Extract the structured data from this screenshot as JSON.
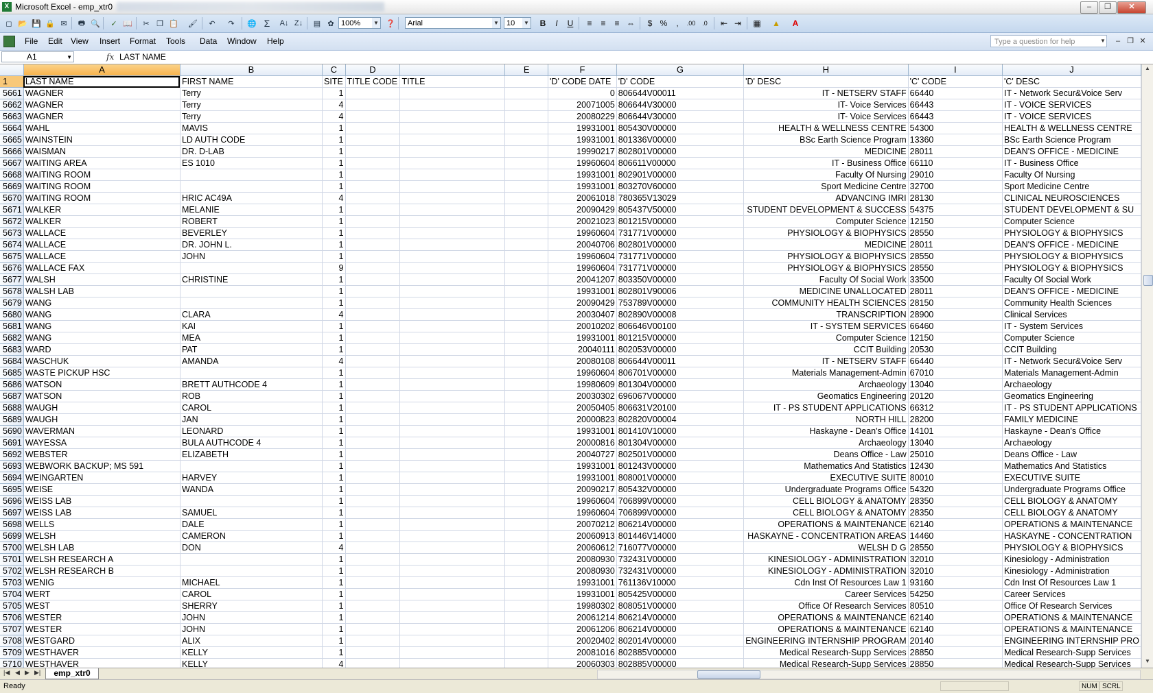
{
  "window": {
    "title": "Microsoft Excel - emp_xtr0",
    "app_icon": "X"
  },
  "toolbar": {
    "zoom": "100%",
    "font_name": "Arial",
    "font_size": "10",
    "icons": [
      "new-icon",
      "open-icon",
      "save-icon",
      "permission-icon",
      "print-icon",
      "print-preview-icon",
      "spelling-icon",
      "research-icon",
      "cut-icon",
      "copy-icon",
      "paste-icon",
      "format-painter-icon",
      "undo-icon",
      "redo-icon",
      "hyperlink-icon",
      "autosum-icon",
      "sort-ascending-icon",
      "sort-descending-icon",
      "chart-wizard-icon",
      "drawing-icon",
      "help-icon"
    ]
  },
  "menu": {
    "items": [
      "File",
      "Edit",
      "View",
      "Insert",
      "Format",
      "Tools",
      "Data",
      "Window",
      "Help"
    ],
    "help_placeholder": "Type a question for help"
  },
  "formula_bar": {
    "name_box": "A1",
    "fx": "fx",
    "content": "LAST NAME"
  },
  "grid": {
    "columns": [
      "A",
      "B",
      "C",
      "D",
      "E",
      "F",
      "G",
      "H",
      "I",
      "J"
    ],
    "selected_column": "A",
    "header_row": {
      "num": "1",
      "cells": [
        "LAST NAME",
        "FIRST NAME",
        "SITE",
        "TITLE CODE",
        "TITLE",
        "",
        "'D' CODE DATE",
        "'D' CODE",
        "'D' DESC",
        "'C' CODE",
        "'C' DESC"
      ]
    },
    "rows": [
      [
        "5661",
        "WAGNER",
        "Terry",
        "1",
        "",
        "",
        "",
        "0",
        "806644V00011",
        "IT - NETSERV STAFF",
        "66440",
        "IT - Network Secur&Voice Serv"
      ],
      [
        "5662",
        "WAGNER",
        "Terry",
        "4",
        "",
        "",
        "",
        "20071005",
        "806644V30000",
        "IT- Voice Services",
        "66443",
        "IT - VOICE SERVICES"
      ],
      [
        "5663",
        "WAGNER",
        "Terry",
        "4",
        "",
        "",
        "",
        "20080229",
        "806644V30000",
        "IT- Voice Services",
        "66443",
        "IT - VOICE SERVICES"
      ],
      [
        "5664",
        "WAHL",
        "MAVIS",
        "1",
        "",
        "",
        "",
        "19931001",
        "805430V00000",
        "HEALTH & WELLNESS CENTRE",
        "54300",
        "HEALTH & WELLNESS CENTRE"
      ],
      [
        "5665",
        "WAINSTEIN",
        "LD AUTH CODE",
        "1",
        "",
        "",
        "",
        "19931001",
        "801336V00000",
        "BSc Earth Science Program",
        "13360",
        "BSc Earth Science Program"
      ],
      [
        "5666",
        "WAISMAN",
        "DR. D-LAB",
        "1",
        "",
        "",
        "",
        "19990217",
        "802801V00000",
        "MEDICINE",
        "28011",
        "DEAN'S OFFICE - MEDICINE"
      ],
      [
        "5667",
        "WAITING AREA",
        "ES 1010",
        "1",
        "",
        "",
        "",
        "19960604",
        "806611V00000",
        "IT - Business Office",
        "66110",
        "IT - Business Office"
      ],
      [
        "5668",
        "WAITING ROOM",
        "",
        "1",
        "",
        "",
        "",
        "19931001",
        "802901V00000",
        "Faculty Of Nursing",
        "29010",
        "Faculty Of Nursing"
      ],
      [
        "5669",
        "WAITING ROOM",
        "",
        "1",
        "",
        "",
        "",
        "19931001",
        "803270V60000",
        "Sport Medicine Centre",
        "32700",
        "Sport Medicine Centre"
      ],
      [
        "5670",
        "WAITING ROOM",
        "HRIC AC49A",
        "4",
        "",
        "",
        "",
        "20061018",
        "780365V13029",
        "ADVANCING IMRI",
        "28130",
        "CLINICAL NEUROSCIENCES"
      ],
      [
        "5671",
        "WALKER",
        "MELANIE",
        "1",
        "",
        "",
        "",
        "20090429",
        "805437V50000",
        "STUDENT DEVELOPMENT & SUCCESS",
        "54375",
        "STUDENT DEVELOPMENT & SU"
      ],
      [
        "5672",
        "WALKER",
        "ROBERT",
        "1",
        "",
        "",
        "",
        "20021023",
        "801215V00000",
        "Computer Science",
        "12150",
        "Computer Science"
      ],
      [
        "5673",
        "WALLACE",
        "BEVERLEY",
        "1",
        "",
        "",
        "",
        "19960604",
        "731771V00000",
        "PHYSIOLOGY & BIOPHYSICS",
        "28550",
        "PHYSIOLOGY & BIOPHYSICS"
      ],
      [
        "5674",
        "WALLACE",
        "DR. JOHN L.",
        "1",
        "",
        "",
        "",
        "20040706",
        "802801V00000",
        "MEDICINE",
        "28011",
        "DEAN'S OFFICE - MEDICINE"
      ],
      [
        "5675",
        "WALLACE",
        "JOHN",
        "1",
        "",
        "",
        "",
        "19960604",
        "731771V00000",
        "PHYSIOLOGY & BIOPHYSICS",
        "28550",
        "PHYSIOLOGY & BIOPHYSICS"
      ],
      [
        "5676",
        "WALLACE FAX",
        "",
        "9",
        "",
        "",
        "",
        "19960604",
        "731771V00000",
        "PHYSIOLOGY & BIOPHYSICS",
        "28550",
        "PHYSIOLOGY & BIOPHYSICS"
      ],
      [
        "5677",
        "WALSH",
        "CHRISTINE",
        "1",
        "",
        "",
        "",
        "20041207",
        "803350V00000",
        "Faculty Of Social Work",
        "33500",
        "Faculty Of Social Work"
      ],
      [
        "5678",
        "WALSH LAB",
        "",
        "1",
        "",
        "",
        "",
        "19931001",
        "802801V90006",
        "MEDICINE UNALLOCATED",
        "28011",
        "DEAN'S OFFICE - MEDICINE"
      ],
      [
        "5679",
        "WANG",
        "",
        "1",
        "",
        "",
        "",
        "20090429",
        "753789V00000",
        "COMMUNITY HEALTH SCIENCES",
        "28150",
        "Community Health Sciences"
      ],
      [
        "5680",
        "WANG",
        "CLARA",
        "4",
        "",
        "",
        "",
        "20030407",
        "802890V00008",
        "TRANSCRIPTION",
        "28900",
        "Clinical Services"
      ],
      [
        "5681",
        "WANG",
        "KAI",
        "1",
        "",
        "",
        "",
        "20010202",
        "806646V00100",
        "IT - SYSTEM SERVICES",
        "66460",
        "IT - System Services"
      ],
      [
        "5682",
        "WANG",
        "MEA",
        "1",
        "",
        "",
        "",
        "19931001",
        "801215V00000",
        "Computer Science",
        "12150",
        "Computer Science"
      ],
      [
        "5683",
        "WARD",
        "PAT",
        "1",
        "",
        "",
        "",
        "20040111",
        "802053V00000",
        "CCIT Building",
        "20530",
        "CCIT Building"
      ],
      [
        "5684",
        "WASCHUK",
        "AMANDA",
        "4",
        "",
        "",
        "",
        "20080108",
        "806644V00011",
        "IT - NETSERV STAFF",
        "66440",
        "IT - Network Secur&Voice Serv"
      ],
      [
        "5685",
        "WASTE PICKUP HSC",
        "",
        "1",
        "",
        "",
        "",
        "19960604",
        "806701V00000",
        "Materials Management-Admin",
        "67010",
        "Materials Management-Admin"
      ],
      [
        "5686",
        "WATSON",
        "BRETT AUTHCODE 4",
        "1",
        "",
        "",
        "",
        "19980609",
        "801304V00000",
        "Archaeology",
        "13040",
        "Archaeology"
      ],
      [
        "5687",
        "WATSON",
        "ROB",
        "1",
        "",
        "",
        "",
        "20030302",
        "696067V00000",
        "Geomatics Engineering",
        "20120",
        "Geomatics Engineering"
      ],
      [
        "5688",
        "WAUGH",
        "CAROL",
        "1",
        "",
        "",
        "",
        "20050405",
        "806631V20100",
        "IT - PS STUDENT APPLICATIONS",
        "66312",
        "IT - PS STUDENT APPLICATIONS"
      ],
      [
        "5689",
        "WAUGH",
        "JAN",
        "1",
        "",
        "",
        "",
        "20000823",
        "802820V00004",
        "NORTH HILL",
        "28200",
        "FAMILY MEDICINE"
      ],
      [
        "5690",
        "WAVERMAN",
        "LEONARD",
        "1",
        "",
        "",
        "",
        "19931001",
        "801410V10000",
        "Haskayne - Dean's Office",
        "14101",
        "Haskayne - Dean's Office"
      ],
      [
        "5691",
        "WAYESSA",
        "BULA AUTHCODE 4",
        "1",
        "",
        "",
        "",
        "20000816",
        "801304V00000",
        "Archaeology",
        "13040",
        "Archaeology"
      ],
      [
        "5692",
        "WEBSTER",
        "ELIZABETH",
        "1",
        "",
        "",
        "",
        "20040727",
        "802501V00000",
        "Deans Office - Law",
        "25010",
        "Deans Office - Law"
      ],
      [
        "5693",
        "WEBWORK BACKUP; MS 591",
        "",
        "1",
        "",
        "",
        "",
        "19931001",
        "801243V00000",
        "Mathematics And Statistics",
        "12430",
        "Mathematics And Statistics"
      ],
      [
        "5694",
        "WEINGARTEN",
        "HARVEY",
        "1",
        "",
        "",
        "",
        "19931001",
        "808001V00000",
        "EXECUTIVE SUITE",
        "80010",
        "EXECUTIVE SUITE"
      ],
      [
        "5695",
        "WEISE",
        "WANDA",
        "1",
        "",
        "",
        "",
        "20090217",
        "805432V00000",
        "Undergraduate Programs Office",
        "54320",
        "Undergraduate Programs Office"
      ],
      [
        "5696",
        "WEISS LAB",
        "",
        "1",
        "",
        "",
        "",
        "19960604",
        "706899V00000",
        "CELL BIOLOGY & ANATOMY",
        "28350",
        "CELL BIOLOGY & ANATOMY"
      ],
      [
        "5697",
        "WEISS LAB",
        "SAMUEL",
        "1",
        "",
        "",
        "",
        "19960604",
        "706899V00000",
        "CELL BIOLOGY & ANATOMY",
        "28350",
        "CELL BIOLOGY & ANATOMY"
      ],
      [
        "5698",
        "WELLS",
        "DALE",
        "1",
        "",
        "",
        "",
        "20070212",
        "806214V00000",
        "OPERATIONS & MAINTENANCE",
        "62140",
        "OPERATIONS & MAINTENANCE"
      ],
      [
        "5699",
        "WELSH",
        "CAMERON",
        "1",
        "",
        "",
        "",
        "20060913",
        "801446V14000",
        "HASKAYNE - CONCENTRATION AREAS",
        "14460",
        "HASKAYNE - CONCENTRATION"
      ],
      [
        "5700",
        "WELSH LAB",
        "DON",
        "4",
        "",
        "",
        "",
        "20060612",
        "716077V00000",
        "WELSH D G",
        "28550",
        "PHYSIOLOGY & BIOPHYSICS"
      ],
      [
        "5701",
        "WELSH RESEARCH A",
        "",
        "1",
        "",
        "",
        "",
        "20080930",
        "732431V00000",
        "KINESIOLOGY - ADMINISTRATION",
        "32010",
        "Kinesiology - Administration"
      ],
      [
        "5702",
        "WELSH RESEARCH B",
        "",
        "1",
        "",
        "",
        "",
        "20080930",
        "732431V00000",
        "KINESIOLOGY - ADMINISTRATION",
        "32010",
        "Kinesiology - Administration"
      ],
      [
        "5703",
        "WENIG",
        "MICHAEL",
        "1",
        "",
        "",
        "",
        "19931001",
        "761136V10000",
        "Cdn Inst Of Resources Law 1",
        "93160",
        "Cdn Inst Of Resources Law 1"
      ],
      [
        "5704",
        "WERT",
        "CAROL",
        "1",
        "",
        "",
        "",
        "19931001",
        "805425V00000",
        "Career Services",
        "54250",
        "Career Services"
      ],
      [
        "5705",
        "WEST",
        "SHERRY",
        "1",
        "",
        "",
        "",
        "19980302",
        "808051V00000",
        "Office Of Research Services",
        "80510",
        "Office Of Research Services"
      ],
      [
        "5706",
        "WESTER",
        "JOHN",
        "1",
        "",
        "",
        "",
        "20061214",
        "806214V00000",
        "OPERATIONS & MAINTENANCE",
        "62140",
        "OPERATIONS & MAINTENANCE"
      ],
      [
        "5707",
        "WESTER",
        "JOHN",
        "1",
        "",
        "",
        "",
        "20061206",
        "806214V00000",
        "OPERATIONS & MAINTENANCE",
        "62140",
        "OPERATIONS & MAINTENANCE"
      ],
      [
        "5708",
        "WESTGARD",
        "ALIX",
        "1",
        "",
        "",
        "",
        "20020402",
        "802014V00000",
        "ENGINEERING INTERNSHIP PROGRAM",
        "20140",
        "ENGINEERING INTERNSHIP PRO"
      ],
      [
        "5709",
        "WESTHAVER",
        "KELLY",
        "1",
        "",
        "",
        "",
        "20081016",
        "802885V00000",
        "Medical Research-Supp Services",
        "28850",
        "Medical Research-Supp Services"
      ],
      [
        "5710",
        "WESTHAVER",
        "KELLY",
        "4",
        "",
        "",
        "",
        "20060303",
        "802885V00000",
        "Medical Research-Supp Services",
        "28850",
        "Medical Research-Supp Services"
      ]
    ]
  },
  "sheet_tabs": {
    "active": "emp_xtr0"
  },
  "status": {
    "text": "Ready",
    "num": "NUM",
    "scrl": "SCRL"
  }
}
